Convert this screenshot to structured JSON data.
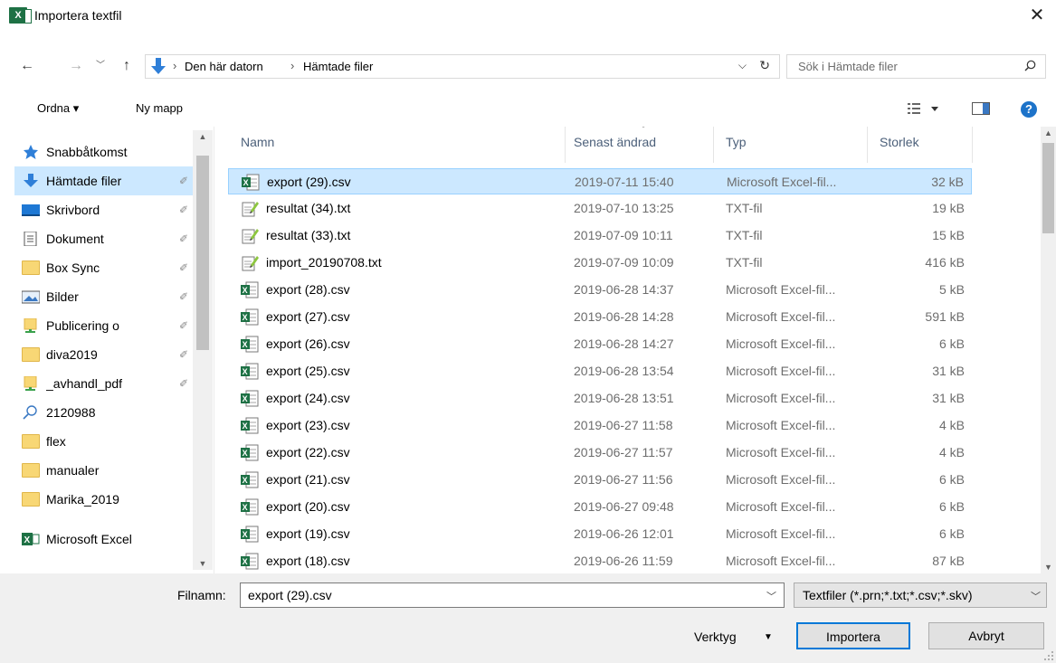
{
  "window": {
    "title": "Importera textfil",
    "close_icon": "close-icon",
    "app_icon_letter": "X"
  },
  "navigation": {
    "back_icon": "arrow-left-icon",
    "forward_icon": "arrow-right-icon",
    "recent_icon": "chevron-down-icon",
    "up_icon": "arrow-up-icon",
    "breadcrumbs": [
      "Den här datorn",
      "Hämtade filer"
    ],
    "refresh_icon": "refresh-icon",
    "search_placeholder": "Sök i Hämtade filer"
  },
  "toolbar": {
    "organize_label": "Ordna ▾",
    "new_folder_label": "Ny mapp",
    "help_label": "?"
  },
  "sidebar": {
    "items": [
      {
        "label": "Snabbåtkomst",
        "icon": "star-icon",
        "pinned": false
      },
      {
        "label": "Hämtade filer",
        "icon": "downloads-icon",
        "pinned": true,
        "selected": true
      },
      {
        "label": "Skrivbord",
        "icon": "desktop-icon",
        "pinned": true
      },
      {
        "label": "Dokument",
        "icon": "document-icon",
        "pinned": true
      },
      {
        "label": "Box Sync",
        "icon": "folder-icon",
        "pinned": true
      },
      {
        "label": "Bilder",
        "icon": "pictures-icon",
        "pinned": true
      },
      {
        "label": "Publicering o",
        "icon": "network-folder-icon",
        "pinned": true
      },
      {
        "label": "diva2019",
        "icon": "folder-icon",
        "pinned": true
      },
      {
        "label": "_avhandl_pdf",
        "icon": "network-folder-icon",
        "pinned": true
      },
      {
        "label": "2120988",
        "icon": "search-icon",
        "pinned": false
      },
      {
        "label": "flex",
        "icon": "folder-icon",
        "pinned": false
      },
      {
        "label": "manualer",
        "icon": "folder-icon",
        "pinned": false
      },
      {
        "label": "Marika_2019",
        "icon": "folder-icon",
        "pinned": false
      },
      {
        "label": "Microsoft Excel",
        "icon": "excel-icon",
        "pinned": false
      }
    ]
  },
  "filelist": {
    "columns": {
      "name": "Namn",
      "modified": "Senast ändrad",
      "type": "Typ",
      "size": "Storlek"
    },
    "rows": [
      {
        "name": "export (29).csv",
        "modified": "2019-07-11 15:40",
        "type": "Microsoft Excel-fil...",
        "size": "32 kB",
        "icon": "excel-file-icon",
        "selected": true
      },
      {
        "name": "resultat (34).txt",
        "modified": "2019-07-10 13:25",
        "type": "TXT-fil",
        "size": "19 kB",
        "icon": "text-file-icon"
      },
      {
        "name": "resultat (33).txt",
        "modified": "2019-07-09 10:11",
        "type": "TXT-fil",
        "size": "15 kB",
        "icon": "text-file-icon"
      },
      {
        "name": "import_20190708.txt",
        "modified": "2019-07-09 10:09",
        "type": "TXT-fil",
        "size": "416 kB",
        "icon": "text-file-icon"
      },
      {
        "name": "export (28).csv",
        "modified": "2019-06-28 14:37",
        "type": "Microsoft Excel-fil...",
        "size": "5 kB",
        "icon": "excel-file-icon"
      },
      {
        "name": "export (27).csv",
        "modified": "2019-06-28 14:28",
        "type": "Microsoft Excel-fil...",
        "size": "591 kB",
        "icon": "excel-file-icon"
      },
      {
        "name": "export (26).csv",
        "modified": "2019-06-28 14:27",
        "type": "Microsoft Excel-fil...",
        "size": "6 kB",
        "icon": "excel-file-icon"
      },
      {
        "name": "export (25).csv",
        "modified": "2019-06-28 13:54",
        "type": "Microsoft Excel-fil...",
        "size": "31 kB",
        "icon": "excel-file-icon"
      },
      {
        "name": "export (24).csv",
        "modified": "2019-06-28 13:51",
        "type": "Microsoft Excel-fil...",
        "size": "31 kB",
        "icon": "excel-file-icon"
      },
      {
        "name": "export (23).csv",
        "modified": "2019-06-27 11:58",
        "type": "Microsoft Excel-fil...",
        "size": "4 kB",
        "icon": "excel-file-icon"
      },
      {
        "name": "export (22).csv",
        "modified": "2019-06-27 11:57",
        "type": "Microsoft Excel-fil...",
        "size": "4 kB",
        "icon": "excel-file-icon"
      },
      {
        "name": "export (21).csv",
        "modified": "2019-06-27 11:56",
        "type": "Microsoft Excel-fil...",
        "size": "6 kB",
        "icon": "excel-file-icon"
      },
      {
        "name": "export (20).csv",
        "modified": "2019-06-27 09:48",
        "type": "Microsoft Excel-fil...",
        "size": "6 kB",
        "icon": "excel-file-icon"
      },
      {
        "name": "export (19).csv",
        "modified": "2019-06-26 12:01",
        "type": "Microsoft Excel-fil...",
        "size": "6 kB",
        "icon": "excel-file-icon"
      },
      {
        "name": "export (18).csv",
        "modified": "2019-06-26 11:59",
        "type": "Microsoft Excel-fil...",
        "size": "87 kB",
        "icon": "excel-file-icon"
      }
    ]
  },
  "footer": {
    "filename_label": "Filnamn:",
    "filename_value": "export (29).csv",
    "filter_value": "Textfiler (*.prn;*.txt;*.csv;*.skv)",
    "tools_label": "Verktyg",
    "import_label": "Importera",
    "cancel_label": "Avbryt"
  },
  "colors": {
    "selection": "#cce8ff",
    "accent": "#0078d7",
    "excel_green": "#1e7145",
    "folder_yellow": "#f8d775"
  }
}
